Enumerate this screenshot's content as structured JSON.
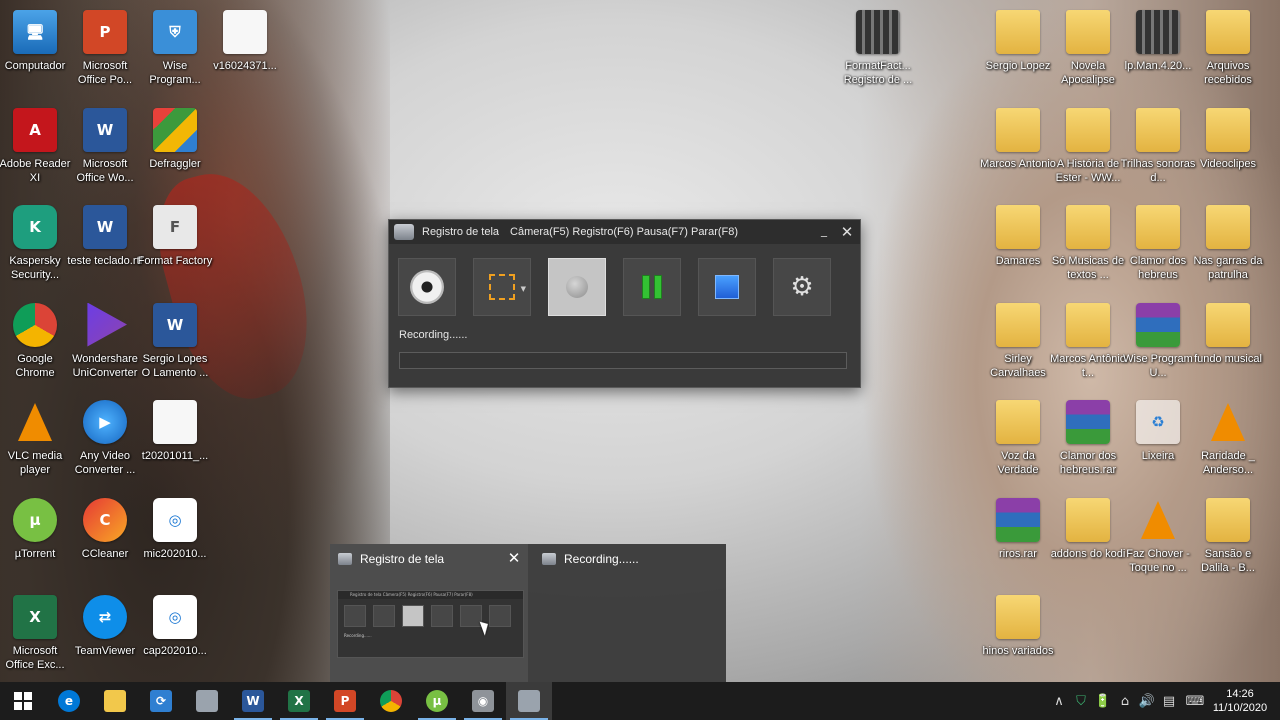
{
  "desktop": {
    "icons": [
      {
        "label": "Computador",
        "glyph": "🖥",
        "icon": "computer-icon",
        "type": "pc"
      },
      {
        "label": "Microsoft Office Po...",
        "glyph": "P",
        "icon": "powerpoint-icon",
        "type": "ppt"
      },
      {
        "label": "Wise Program...",
        "glyph": "⛨",
        "icon": "wise-program-icon",
        "type": "shield"
      },
      {
        "label": "v16024371...",
        "glyph": "",
        "icon": "file-icon",
        "type": "file"
      },
      {
        "label": "Adobe Reader XI",
        "glyph": "A",
        "icon": "adobe-reader-icon",
        "type": "pdf"
      },
      {
        "label": "Microsoft Office Wo...",
        "glyph": "W",
        "icon": "word-icon",
        "type": "word"
      },
      {
        "label": "Defraggler",
        "glyph": "",
        "icon": "defraggler-icon",
        "type": "defrag"
      },
      {
        "label": "Kaspersky Security...",
        "glyph": "K",
        "icon": "kaspersky-icon",
        "type": "kasp"
      },
      {
        "label": "teste teclado.rtf",
        "glyph": "W",
        "icon": "rtf-document-icon",
        "type": "word"
      },
      {
        "label": "Format Factory",
        "glyph": "F",
        "icon": "format-factory-icon",
        "type": "format"
      },
      {
        "label": "Google Chrome",
        "glyph": "",
        "icon": "chrome-icon",
        "type": "chrome"
      },
      {
        "label": "Wondershare UniConverter",
        "glyph": "",
        "icon": "wondershare-icon",
        "type": "wonder"
      },
      {
        "label": "Sergio Lopes O Lamento ...",
        "glyph": "W",
        "icon": "word-document-icon",
        "type": "word"
      },
      {
        "label": "VLC media player",
        "glyph": "",
        "icon": "vlc-icon",
        "type": "vlc"
      },
      {
        "label": "Any Video Converter ...",
        "glyph": "▶",
        "icon": "any-video-converter-icon",
        "type": "anyvideo"
      },
      {
        "label": "t20201011_...",
        "glyph": "",
        "icon": "text-file-icon",
        "type": "file"
      },
      {
        "label": "µTorrent",
        "glyph": "µ",
        "icon": "utorrent-icon",
        "type": "utorrent"
      },
      {
        "label": "CCleaner",
        "glyph": "C",
        "icon": "ccleaner-icon",
        "type": "ccleaner"
      },
      {
        "label": "mic202010...",
        "glyph": "◎",
        "icon": "audio-file-icon",
        "type": "mic"
      },
      {
        "label": "Microsoft Office Exc...",
        "glyph": "X",
        "icon": "excel-icon",
        "type": "excel"
      },
      {
        "label": "TeamViewer",
        "glyph": "⇄",
        "icon": "teamviewer-icon",
        "type": "teamviewer"
      },
      {
        "label": "cap202010...",
        "glyph": "◎",
        "icon": "capture-file-icon",
        "type": "mic"
      },
      {
        "label": "FormatFact... Registro de ...",
        "glyph": "",
        "icon": "video-file-icon",
        "type": "film"
      },
      {
        "label": "Sergio  Lopez",
        "glyph": "",
        "icon": "vlc-folder-icon",
        "type": "folder"
      },
      {
        "label": "Novela Apocalipse",
        "glyph": "",
        "icon": "video-folder-icon",
        "type": "folder"
      },
      {
        "label": "lp.Man.4.20...",
        "glyph": "",
        "icon": "video-file-icon",
        "type": "film"
      },
      {
        "label": "Arquivos recebidos",
        "glyph": "",
        "icon": "folder-icon",
        "type": "folder"
      },
      {
        "label": "Marcos Antonio",
        "glyph": "",
        "icon": "vlc-folder-icon",
        "type": "folder"
      },
      {
        "label": "A História de Ester - WW...",
        "glyph": "",
        "icon": "video-folder-icon",
        "type": "folder"
      },
      {
        "label": "Trilhas sonoras d...",
        "glyph": "",
        "icon": "vlc-folder-icon",
        "type": "folder"
      },
      {
        "label": "Videoclipes",
        "glyph": "",
        "icon": "folder-icon",
        "type": "folder"
      },
      {
        "label": "Damares",
        "glyph": "",
        "icon": "vlc-folder-icon",
        "type": "folder"
      },
      {
        "label": "Só Musicas de textos ...",
        "glyph": "",
        "icon": "folder-icon",
        "type": "folder"
      },
      {
        "label": "Clamor dos hebreus",
        "glyph": "",
        "icon": "vlc-folder-icon",
        "type": "folder"
      },
      {
        "label": "Nas garras da patrulha",
        "glyph": "",
        "icon": "vlc-folder-icon",
        "type": "folder"
      },
      {
        "label": "Sirley Carvalhaes",
        "glyph": "",
        "icon": "vlc-folder-icon",
        "type": "folder"
      },
      {
        "label": "Marcos Antônio t...",
        "glyph": "",
        "icon": "folder-icon",
        "type": "folder"
      },
      {
        "label": "Wise Program U...",
        "glyph": "",
        "icon": "rar-archive-icon",
        "type": "rar"
      },
      {
        "label": "fundo musical",
        "glyph": "",
        "icon": "folder-icon",
        "type": "folder"
      },
      {
        "label": "Voz da Verdade",
        "glyph": "",
        "icon": "folder-icon",
        "type": "folder"
      },
      {
        "label": "Clamor dos hebreus.rar",
        "glyph": "",
        "icon": "rar-archive-icon",
        "type": "rar"
      },
      {
        "label": "Lixeira",
        "glyph": "♻",
        "icon": "recycle-bin-icon",
        "type": "recycle"
      },
      {
        "label": "Raridade _ Anderso...",
        "glyph": "",
        "icon": "vlc-file-icon",
        "type": "vlc"
      },
      {
        "label": "riros.rar",
        "glyph": "",
        "icon": "rar-archive-icon",
        "type": "rar"
      },
      {
        "label": "addons do kodi",
        "glyph": "",
        "icon": "folder-icon",
        "type": "folder"
      },
      {
        "label": "Faz Chover - Toque no ...",
        "glyph": "",
        "icon": "vlc-file-icon",
        "type": "vlc"
      },
      {
        "label": "Sansão e Dalila - B...",
        "glyph": "",
        "icon": "video-folder-icon",
        "type": "folder"
      },
      {
        "label": "hinos variados",
        "glyph": "",
        "icon": "video-folder-icon",
        "type": "folder"
      }
    ]
  },
  "recorder": {
    "app_title": "Registro de tela",
    "shortcuts": "Câmera(F5) Registro(F6) Pausa(F7) Parar(F8)",
    "minimize_glyph": "_",
    "close_glyph": "✕",
    "status": "Recording......",
    "progress_fraction": 0.0,
    "accent_progress": "#2f8f2f"
  },
  "preview": {
    "title": "Registro de tela",
    "close_glyph": "✕",
    "second_title": "Recording......",
    "mini_title": "Registro de tela   Câmera(F5) Registro(F6) Pausa(F7) Parar(F8)",
    "mini_status": "Recording......"
  },
  "taskbar": {
    "apps": [
      {
        "icon": "edge-icon",
        "glyph": "e",
        "color": "#0078d7"
      },
      {
        "icon": "file-explorer-icon",
        "glyph": "",
        "color": "#f2c84b"
      },
      {
        "icon": "wise-program-taskbar-icon",
        "glyph": "⟳",
        "color": "#2f7fd1"
      },
      {
        "icon": "screen-capture-icon",
        "glyph": "",
        "color": "#9aa3ad"
      },
      {
        "icon": "word-icon",
        "glyph": "W",
        "color": "#2b579a"
      },
      {
        "icon": "excel-icon",
        "glyph": "X",
        "color": "#217346"
      },
      {
        "icon": "powerpoint-icon",
        "glyph": "P",
        "color": "#d24726"
      },
      {
        "icon": "chrome-icon",
        "glyph": "",
        "color": "#db4437"
      },
      {
        "icon": "utorrent-icon",
        "glyph": "µ",
        "color": "#78c043"
      },
      {
        "icon": "webcam-icon",
        "glyph": "◉",
        "color": "#8e9399"
      },
      {
        "icon": "registro-de-tela-icon",
        "glyph": "",
        "color": "#9aa3ad"
      }
    ],
    "tray": {
      "chevron": "∧",
      "defender": "⛉",
      "power": "🔋",
      "network": "⌂",
      "volume": "🔊",
      "notifications": "▤",
      "keyboard": "⌨",
      "time": "14:26",
      "date": "11/10/2020"
    }
  }
}
